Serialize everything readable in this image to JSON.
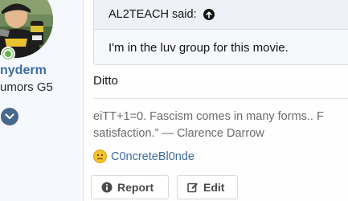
{
  "user": {
    "username": "nyderm",
    "title": "umors G5",
    "online_status": "online",
    "status_color": "#63b34a",
    "avatar_icon": "avatar-photo",
    "expand_icon": "chevron-down-icon"
  },
  "quote": {
    "author_line": "AL2TEACH said:",
    "jump_icon": "arrow-up-circle-icon",
    "text": "I'm in the luv group for this movie."
  },
  "reply": {
    "text": "Ditto"
  },
  "signature": {
    "line1": "eiTT+1=0. Fascism comes in many forms.. F",
    "line2": "satisfaction.” — Clarence Darrow"
  },
  "reactions": {
    "emoji": "confused-face-icon",
    "users": "C0ncreteBl0nde"
  },
  "actions": {
    "report_label": "Report",
    "edit_label": "Edit"
  },
  "colors": {
    "accent": "#3e6ca0",
    "sidebar_bg": "#f5f8fc"
  }
}
